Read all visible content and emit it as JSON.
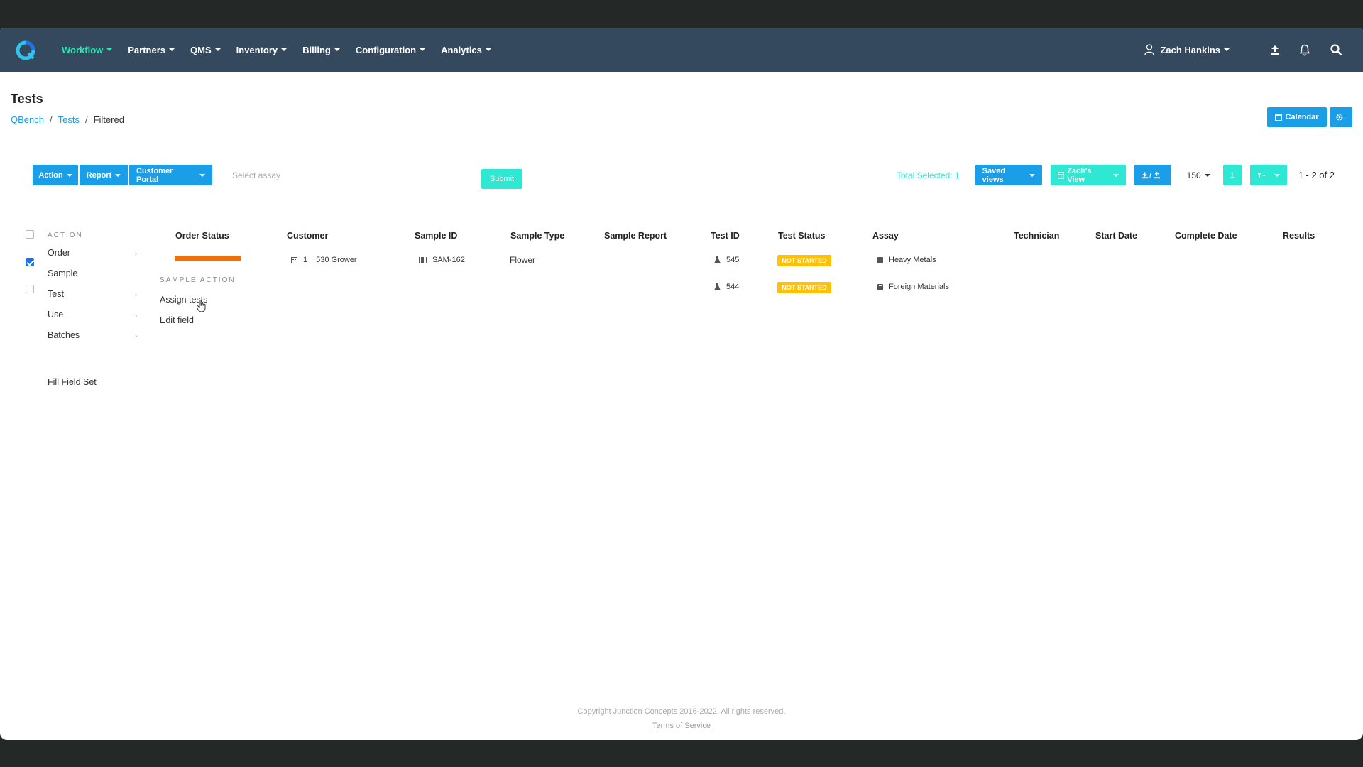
{
  "nav": {
    "items": [
      {
        "label": "Workflow",
        "active": true
      },
      {
        "label": "Partners"
      },
      {
        "label": "QMS"
      },
      {
        "label": "Inventory"
      },
      {
        "label": "Billing"
      },
      {
        "label": "Configuration"
      },
      {
        "label": "Analytics"
      }
    ],
    "user": "Zach Hankins"
  },
  "page": {
    "title": "Tests",
    "breadcrumb": [
      "QBench",
      "Tests",
      "Filtered"
    ]
  },
  "header_buttons": {
    "calendar": "Calendar"
  },
  "toolbar": {
    "action": "Action",
    "report": "Report",
    "customer_portal": "Customer Portal",
    "assay_placeholder": "Select assay",
    "submit": "Submit",
    "total_selected": "Total Selected: 1",
    "saved_views": "Saved views",
    "current_view": "Zach's View",
    "page_size": "150",
    "page_number": "1",
    "page_range": "1 - 2 of 2"
  },
  "table": {
    "columns": [
      "Order Status",
      "Customer",
      "Sample ID",
      "Sample Type",
      "Sample Report",
      "Test ID",
      "Test Status",
      "Assay",
      "Technician",
      "Start Date",
      "Complete Date",
      "Results"
    ],
    "rows": [
      {
        "customer_num": "1",
        "customer": "530 Grower",
        "sample_id": "SAM-162",
        "sample_type": "Flower",
        "test_id": "545",
        "test_status": "NOT STARTED",
        "assay": "Heavy Metals",
        "checked": true
      },
      {
        "test_id": "544",
        "test_status": "NOT STARTED",
        "assay": "Foreign Materials",
        "checked": false
      }
    ]
  },
  "action_menu": {
    "heading": "ACTION",
    "items": [
      "Order",
      "Sample",
      "Test",
      "Use",
      "Batches"
    ],
    "fill_field_set": "Fill Field Set",
    "sub_heading": "SAMPLE ACTION",
    "sub_items": [
      "Assign tests",
      "Edit field"
    ]
  },
  "footer": {
    "copyright": "Copyright Junction Concepts 2016-2022. All rights reserved.",
    "terms": "Terms of Service"
  },
  "colors": {
    "nav_bg": "#34495e",
    "nav_active": "#2ee8b4",
    "primary": "#1a9ee8",
    "teal": "#2ee8d4",
    "warning": "#ffc107",
    "order_status": "#e8720f"
  }
}
